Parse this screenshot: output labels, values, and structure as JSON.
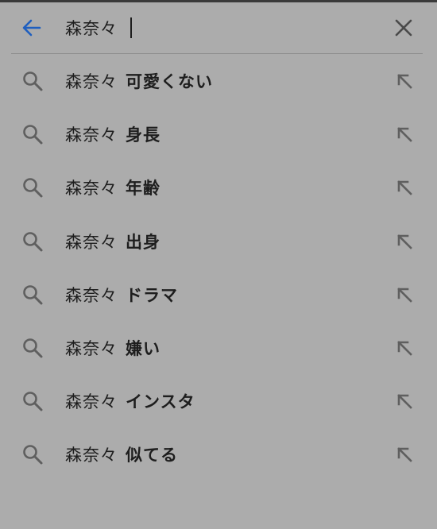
{
  "search": {
    "query": "森奈々"
  },
  "suggestions": [
    {
      "prefix": "森奈々",
      "completion": "可愛くない"
    },
    {
      "prefix": "森奈々",
      "completion": "身長"
    },
    {
      "prefix": "森奈々",
      "completion": "年齢"
    },
    {
      "prefix": "森奈々",
      "completion": "出身"
    },
    {
      "prefix": "森奈々",
      "completion": "ドラマ"
    },
    {
      "prefix": "森奈々",
      "completion": "嫌い"
    },
    {
      "prefix": "森奈々",
      "completion": "インスタ"
    },
    {
      "prefix": "森奈々",
      "completion": "似てる"
    }
  ],
  "icons": {
    "back": "arrow-back-icon",
    "clear": "close-icon",
    "suggestion": "search-icon",
    "fill": "arrow-up-left-icon"
  },
  "colors": {
    "background": "#acacac",
    "accent": "#1f5fbf",
    "icon": "#5f5f5f",
    "text": "#1e1e1e"
  }
}
